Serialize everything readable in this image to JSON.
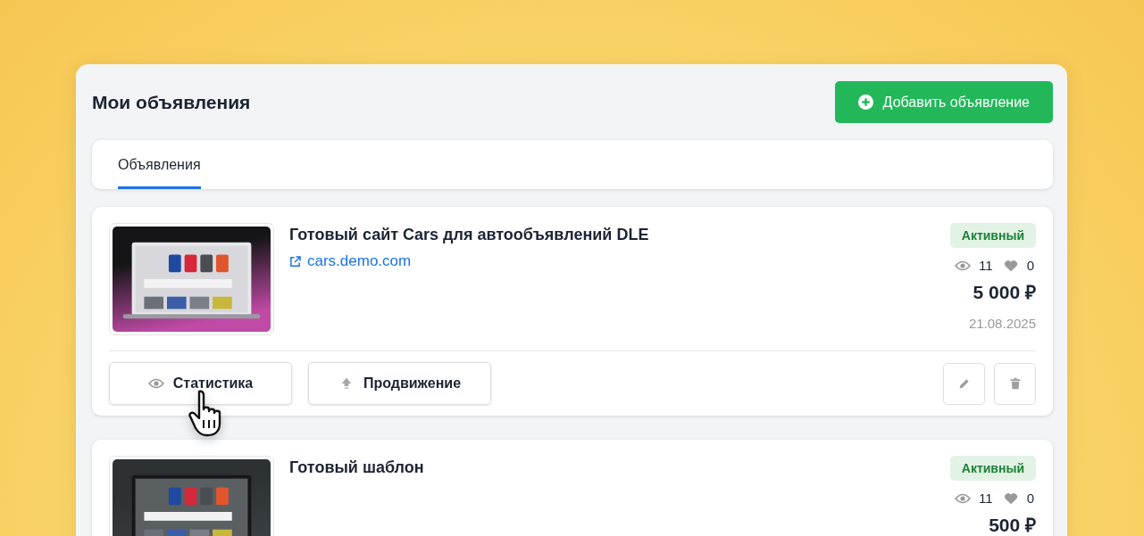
{
  "header": {
    "title": "Мои объявления",
    "add_button": "Добавить объявление"
  },
  "tabs": [
    {
      "label": "Объявления",
      "selected": true
    }
  ],
  "listings": [
    {
      "title": "Готовый сайт Cars для автообъявлений DLE",
      "link": "cars.demo.com",
      "status": {
        "label": "Активный",
        "kind": "active"
      },
      "views": "11",
      "likes": "0",
      "price": "5 000 ₽",
      "date": "21.08.2025",
      "actions": [
        {
          "label": "Статистика",
          "kind": "stats",
          "hovered": true
        },
        {
          "label": "Продвижение",
          "kind": "promote",
          "hovered": false
        }
      ]
    },
    {
      "title": "Готовый шаблон",
      "status": {
        "label": "Активный",
        "kind": "active"
      },
      "views": "11",
      "likes": "0",
      "price": "500 ₽"
    }
  ]
}
